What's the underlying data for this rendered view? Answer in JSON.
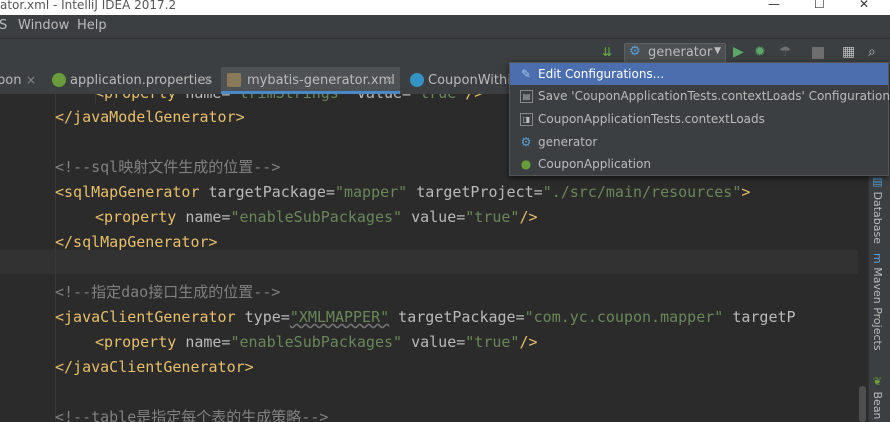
{
  "window": {
    "title": "ator.xml - IntelliJ IDEA 2017.2",
    "controls": {
      "minimize": "—",
      "maximize": "☐",
      "close": "✕"
    }
  },
  "menu": {
    "items": [
      "S",
      "Window",
      "Help"
    ]
  },
  "toolbar": {
    "run_config": "generator",
    "icons": [
      "build-icon",
      "run-icon",
      "debug-icon",
      "coverage-icon",
      "stop-icon",
      "project-structure-icon",
      "search-icon"
    ]
  },
  "tabs": [
    {
      "label": "pon",
      "close": "×"
    },
    {
      "label": "application.properties",
      "close": "×"
    },
    {
      "label": "mybatis-generator.xml",
      "close": "×",
      "active": true
    },
    {
      "label": "CouponWithin"
    }
  ],
  "code": {
    "l0": {
      "a": "<property ",
      "b": "name=",
      "c": "\"trimStrings\"",
      "d": " value=",
      "e": "\"true\"",
      "f": "/>"
    },
    "l1": {
      "a": "</javaModelGenerator>"
    },
    "l3": {
      "a": "<!--sql映射文件生成的位置-->"
    },
    "l4": {
      "a": "<sqlMapGenerator ",
      "b": "targetPackage=",
      "c": "\"mapper\"",
      "d": " targetProject=",
      "e": "\"./src/main/resources\"",
      "f": ">"
    },
    "l5": {
      "a": "<property ",
      "b": "name=",
      "c": "\"enableSubPackages\"",
      "d": " value=",
      "e": "\"true\"",
      "f": "/>"
    },
    "l6": {
      "a": "</sqlMapGenerator>"
    },
    "l8": {
      "a": "<!--指定dao接口生成的位置-->"
    },
    "l9": {
      "a": "<javaClientGenerator ",
      "b": "type=",
      "c": "\"XMLMAPPER\"",
      "d": " targetPackage=",
      "e": "\"com.yc.coupon.mapper\"",
      "f": " targetP"
    },
    "l10": {
      "a": "<property ",
      "b": "name=",
      "c": "\"enableSubPackages\"",
      "d": " value=",
      "e": "\"true\"",
      "f": "/>"
    },
    "l11": {
      "a": "</javaClientGenerator>"
    },
    "l13": {
      "a": "<!--table是指定每个表的生成策略-->"
    }
  },
  "dropdown": {
    "items": [
      {
        "label": "Edit Configurations...",
        "icon": "edit-config-icon",
        "selected": true
      },
      {
        "label": "Save 'CouponApplicationTests.contextLoads' Configuration",
        "icon": "save-config-icon"
      },
      {
        "label": "CouponApplicationTests.contextLoads",
        "icon": "junit-icon"
      },
      {
        "label": "generator",
        "icon": "gear-icon"
      },
      {
        "label": "CouponApplication",
        "icon": "spring-boot-icon"
      }
    ]
  },
  "right_sidebar": {
    "items": [
      {
        "label": "Database"
      },
      {
        "label": "Maven Projects"
      },
      {
        "label": "Bean"
      }
    ]
  },
  "colors": {
    "accent": "#4b6eaf",
    "tag": "#e8bf6a",
    "string": "#6a8759",
    "comment": "#808080",
    "background": "#2b2b2b"
  }
}
